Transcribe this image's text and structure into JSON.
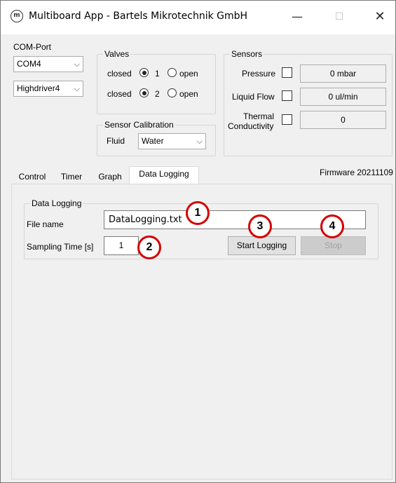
{
  "window": {
    "title": "Multiboard App - Bartels Mikrotechnik GmbH",
    "app_icon_glyph": "m",
    "minimize_glyph": "—",
    "maximize_glyph": "☐",
    "close_glyph": "✕"
  },
  "com_port": {
    "label": "COM-Port",
    "port_value": "COM4",
    "driver_value": "Highdriver4",
    "dropdown_glyph": "⌵"
  },
  "valves": {
    "title": "Valves",
    "rows": [
      {
        "closed_label": "closed",
        "number": "1",
        "open_label": "open",
        "closed_checked": true
      },
      {
        "closed_label": "closed",
        "number": "2",
        "open_label": "open",
        "closed_checked": true
      }
    ]
  },
  "sensor_calibration": {
    "title": "Sensor Calibration",
    "fluid_label": "Fluid",
    "fluid_value": "Water"
  },
  "sensors": {
    "title": "Sensors",
    "rows": [
      {
        "label": "Pressure",
        "value": "0 mbar"
      },
      {
        "label": "Liquid Flow",
        "value": "0 ul/min"
      },
      {
        "label_line1": "Thermal",
        "label_line2": "Conductivity",
        "value": "0"
      }
    ]
  },
  "firmware": "Firmware 20211109",
  "tabs": [
    {
      "label": "Control",
      "active": false
    },
    {
      "label": "Timer",
      "active": false
    },
    {
      "label": "Graph",
      "active": false
    },
    {
      "label": "Data Logging",
      "active": true
    }
  ],
  "data_logging": {
    "group_title": "Data Logging",
    "file_name_label": "File name",
    "file_name_value": "DataLogging.txt",
    "sampling_label": "Sampling Time [s]",
    "sampling_value": "1",
    "start_button": "Start Logging",
    "stop_button": "Stop"
  },
  "callouts": [
    "1",
    "2",
    "3",
    "4"
  ],
  "colors": {
    "callout_border": "#d40000",
    "window_bg": "#f0f0f0"
  }
}
